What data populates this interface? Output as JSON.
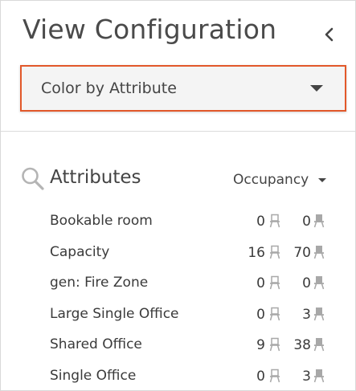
{
  "header": {
    "title": "View Configuration",
    "collapse_icon": "chevron-left-icon"
  },
  "color_by": {
    "selected": "Color by Attribute",
    "accent_color": "#e2582a"
  },
  "attributes": {
    "title": "Attributes",
    "icon": "search-icon",
    "filter": {
      "selected": "Occupancy"
    },
    "rows": [
      {
        "label": "Bookable room",
        "available": "0",
        "occupied": "0"
      },
      {
        "label": "Capacity",
        "available": "16",
        "occupied": "70"
      },
      {
        "label": "gen: Fire Zone",
        "available": "0",
        "occupied": "0"
      },
      {
        "label": "Large Single Office",
        "available": "0",
        "occupied": "3"
      },
      {
        "label": "Shared Office",
        "available": "9",
        "occupied": "38"
      },
      {
        "label": "Single Office",
        "available": "0",
        "occupied": "3"
      }
    ],
    "available_icon": "chair-outline-icon",
    "occupied_icon": "chair-filled-icon"
  }
}
